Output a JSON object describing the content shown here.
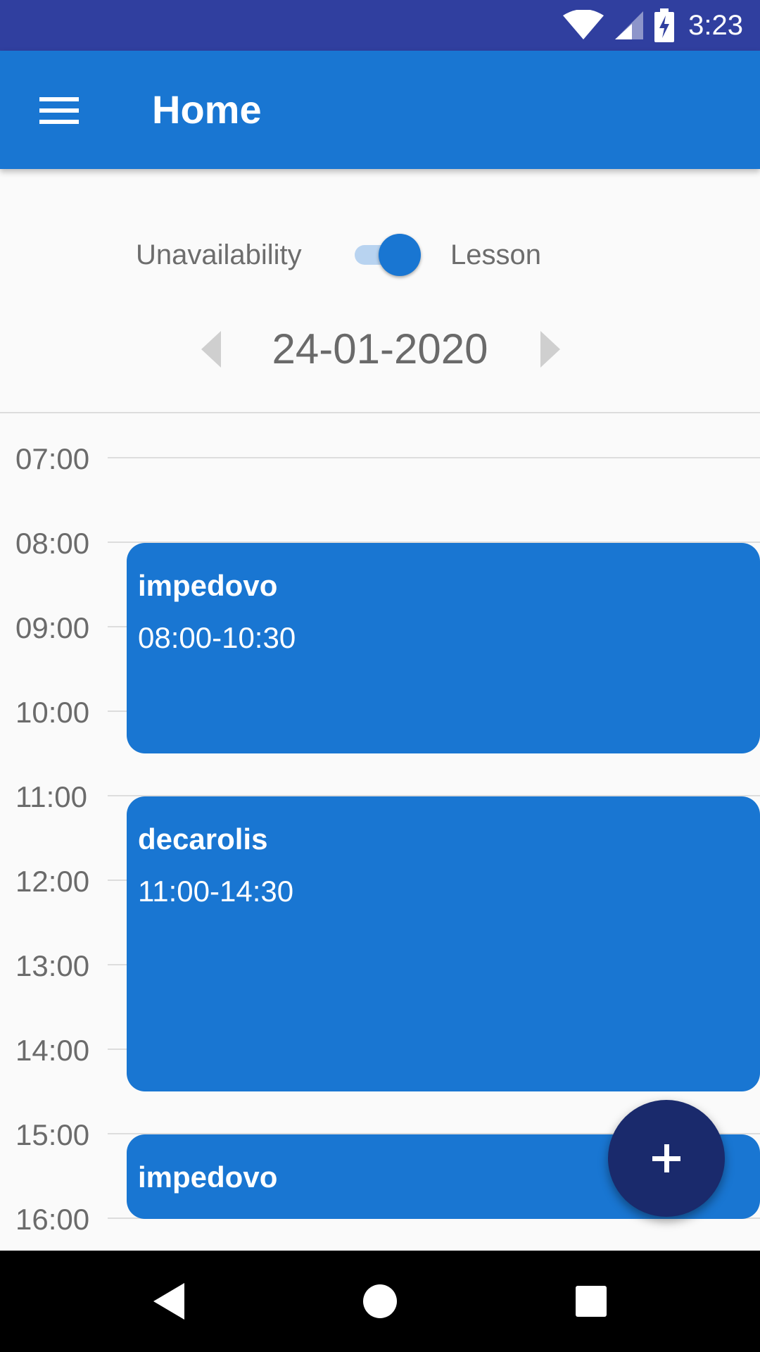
{
  "status_bar": {
    "time": "3:23"
  },
  "app_bar": {
    "title": "Home"
  },
  "mode_toggle": {
    "left_label": "Unavailability",
    "right_label": "Lesson",
    "checked": true
  },
  "date_nav": {
    "date": "24-01-2020"
  },
  "timeline": {
    "hours": [
      "07:00",
      "08:00",
      "09:00",
      "10:00",
      "11:00",
      "12:00",
      "13:00",
      "14:00",
      "15:00",
      "16:00"
    ]
  },
  "events": [
    {
      "title": "impedovo",
      "time": "08:00-10:30"
    },
    {
      "title": "decarolis",
      "time": "11:00-14:30"
    },
    {
      "title": "impedovo",
      "time": ""
    }
  ],
  "colors": {
    "primary": "#1976D2",
    "primary_dark": "#303F9F",
    "fab": "#1A2A6C"
  }
}
